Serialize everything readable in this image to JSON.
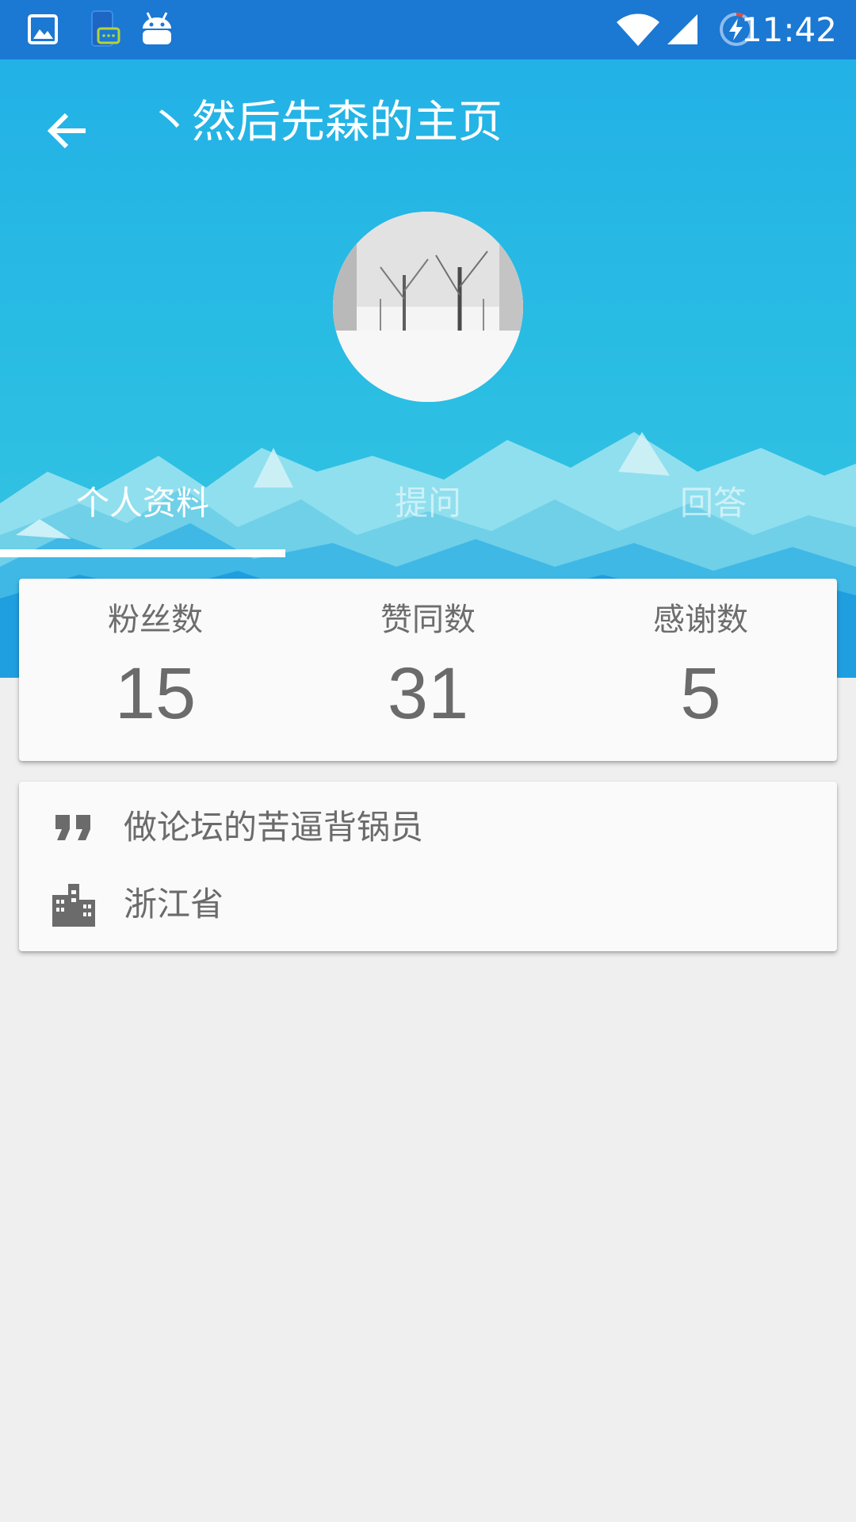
{
  "status_bar": {
    "time": "11:42",
    "left_icons": [
      "image-icon",
      "chat-notification-icon",
      "android-icon"
    ],
    "right_icons": [
      "wifi-icon",
      "cell-signal-icon",
      "battery-charging-icon"
    ]
  },
  "header": {
    "title": "丶然后先森的主页",
    "back_icon": "arrow-left-icon",
    "avatar": "profile-avatar",
    "colors": {
      "sky_top": "#23b1e6",
      "sky_bottom": "#37c6e2"
    }
  },
  "tabs": [
    {
      "label": "个人资料",
      "active": true
    },
    {
      "label": "提问",
      "active": false
    },
    {
      "label": "回答",
      "active": false
    }
  ],
  "stats": [
    {
      "label": "粉丝数",
      "value": "15"
    },
    {
      "label": "赞同数",
      "value": "31"
    },
    {
      "label": "感谢数",
      "value": "5"
    }
  ],
  "info": {
    "bio": {
      "icon": "quote-icon",
      "text": "做论坛的苦逼背锅员"
    },
    "location": {
      "icon": "city-icon",
      "text": "浙江省"
    }
  },
  "colors": {
    "status_bar": "#1b78d3",
    "page_background": "#efefef",
    "card_background": "#fafafa",
    "text_gray": "#6b6b6b"
  }
}
